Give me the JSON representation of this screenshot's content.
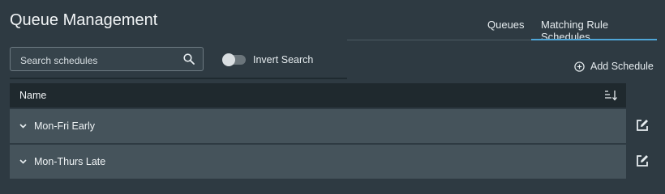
{
  "page": {
    "title": "Queue Management"
  },
  "tabs": [
    {
      "label": "Queues",
      "active": false
    },
    {
      "label": "Matching Rule Schedules",
      "active": true
    }
  ],
  "search": {
    "placeholder": "Search schedules",
    "value": "",
    "icon": "search-icon"
  },
  "invert_search": {
    "label": "Invert Search",
    "enabled": false
  },
  "add_schedule": {
    "label": "Add Schedule",
    "icon": "plus-circle-icon"
  },
  "table": {
    "column": "Name",
    "sort_icon": "sort-icon",
    "rows": [
      {
        "name": "Mon-Fri Early"
      },
      {
        "name": "Mon-Thurs Late"
      }
    ]
  },
  "colors": {
    "background": "#2e3a42",
    "header": "#1f292e",
    "row": "#45535b",
    "accent": "#4fa6d8"
  }
}
